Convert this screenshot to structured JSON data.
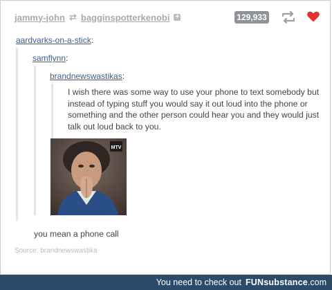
{
  "header": {
    "user1": "jammy-john",
    "reblog_glyph": "⇄",
    "user2": "bagginspotterkenobi",
    "plus_glyph": "+",
    "notes_count": "129,933",
    "reblog_icon": "reblog-icon",
    "like_icon": "heart-icon",
    "like_color": "#e0342c"
  },
  "thread": {
    "level1_name": "aardvarks-on-a-stick",
    "level2_name": "samflynn",
    "level3_name": "brandnewswastikas",
    "colon": ":",
    "quote": "I wish there was some way to use your phone to text somebody but instead of typing stuff you would say it out loud into the phone or something and the other person could hear you and they would just talk out loud back to you.",
    "image_badge": "MTV",
    "reply": "you mean a phone call"
  },
  "source": {
    "text": "Source: brandnewswastika"
  },
  "footer": {
    "prefix": "You need to check out",
    "brand_part1": "FUN",
    "brand_part2": "substance",
    "brand_part3": ".com"
  }
}
